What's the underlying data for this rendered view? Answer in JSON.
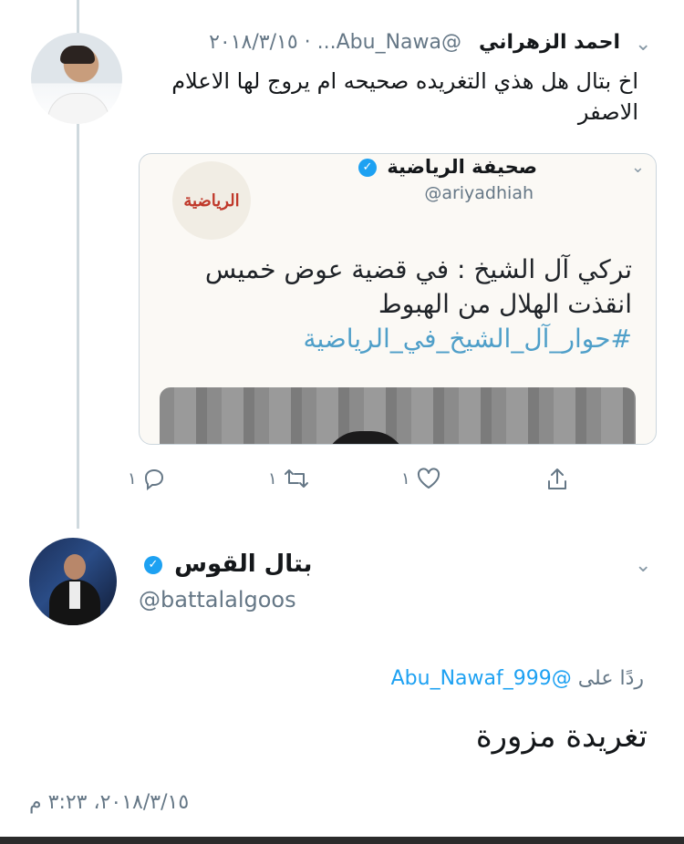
{
  "tweet1": {
    "display_name": "احمد الزهراني",
    "handle": "@Abu_Nawa...",
    "date": "٢٠١٨/٣/١٥",
    "text": "اخ بتال هل هذي التغريده صحيحه ام يروج لها الاعلام الاصفر",
    "quote": {
      "logo_text": "الرياضية",
      "display_name": "صحيفة الرياضية",
      "handle": "@ariyadhiah",
      "text_line1": "تركي آل الشيخ : في قضية عوض خميس",
      "text_line2": "انقذت الهلال من الهبوط",
      "hashtag": "#حوار_آل_الشيخ_في_الرياضية"
    },
    "actions": {
      "reply_count": "١",
      "retweet_count": "١",
      "like_count": "١"
    }
  },
  "tweet2": {
    "display_name": "بتال القوس",
    "handle": "@battalalgoos",
    "replying_prefix": "ردًا على",
    "replying_to": "@Abu_Nawaf_999",
    "text": "تغريدة مزورة",
    "timestamp": "٢٠١٨/٣/١٥، ٣:٢٣ م"
  },
  "icons": {
    "chevron": "chevron-down-icon",
    "verified": "verified-badge-icon",
    "reply": "reply-icon",
    "retweet": "retweet-icon",
    "like": "heart-icon",
    "share": "share-icon"
  },
  "colors": {
    "accent": "#1da1f2",
    "meta": "#657786",
    "hashtag": "#4f9fc9"
  }
}
